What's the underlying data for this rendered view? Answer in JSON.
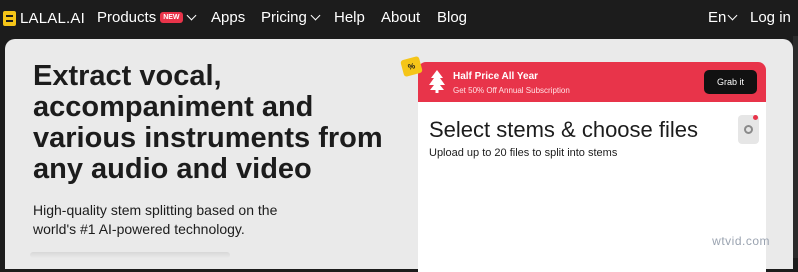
{
  "nav": {
    "logo_text": "LALAL.AI",
    "products": "Products",
    "new_badge": "NEW",
    "apps": "Apps",
    "pricing": "Pricing",
    "help": "Help",
    "about": "About",
    "blog": "Blog",
    "language": "En",
    "login": "Log in"
  },
  "hero": {
    "headline": "Extract vocal, accompaniment and various instruments from any audio and video",
    "subline": "High-quality stem splitting based on the world's #1 AI-powered technology."
  },
  "promo": {
    "percent_badge": "%",
    "title": "Half Price All Year",
    "subtitle": "Get 50% Off Annual Subscription",
    "cta": "Grab it"
  },
  "uploader": {
    "title": "Select stems & choose files",
    "subtitle": "Upload up to 20 files to split into stems"
  },
  "watermark": "wtvid.com",
  "colors": {
    "accent_red": "#e8344a",
    "logo_yellow": "#f5c518",
    "nav_bg": "#1c1c1c",
    "content_bg": "#eaeaea"
  }
}
